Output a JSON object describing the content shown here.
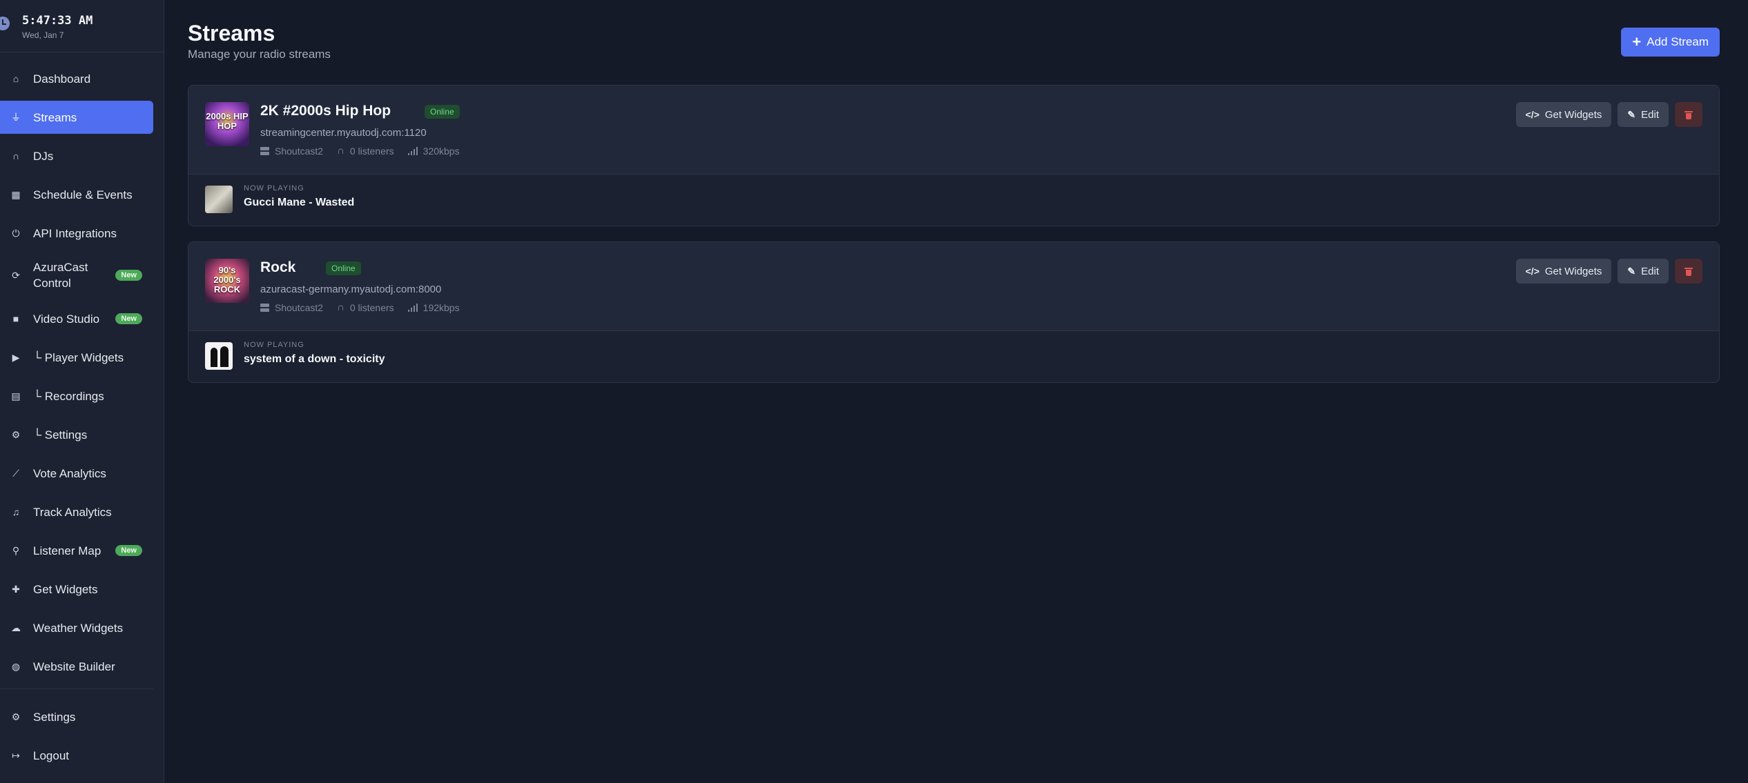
{
  "clock": {
    "time": "5:47:33 AM",
    "date": "Wed, Jan 7"
  },
  "sidebar": {
    "items": [
      {
        "label": "Dashboard",
        "icon": "home-icon"
      },
      {
        "label": "Streams",
        "icon": "broadcast-tower-icon",
        "active": true
      },
      {
        "label": "DJs",
        "icon": "headphones-icon"
      },
      {
        "label": "Schedule & Events",
        "icon": "calendar-icon"
      },
      {
        "label": "API Integrations",
        "icon": "plug-icon"
      },
      {
        "label": "AzuraCast Control",
        "icon": "sync-icon",
        "badge": "New"
      },
      {
        "label": "Video Studio",
        "icon": "video-icon",
        "badge": "New"
      },
      {
        "label": "└ Player Widgets",
        "icon": "play-circle-icon"
      },
      {
        "label": "└ Recordings",
        "icon": "film-icon"
      },
      {
        "label": "└ Settings",
        "icon": "gear-icon"
      },
      {
        "label": "Vote Analytics",
        "icon": "line-chart-icon"
      },
      {
        "label": "Track Analytics",
        "icon": "music-icon"
      },
      {
        "label": "Listener Map",
        "icon": "map-icon",
        "badge": "New"
      },
      {
        "label": "Get Widgets",
        "icon": "puzzle-icon"
      },
      {
        "label": "Weather Widgets",
        "icon": "cloud-sun-icon"
      },
      {
        "label": "Website Builder",
        "icon": "globe-icon"
      }
    ],
    "footer": [
      {
        "label": "Settings",
        "icon": "gear-icon"
      },
      {
        "label": "Logout",
        "icon": "logout-icon"
      }
    ]
  },
  "header": {
    "title": "Streams",
    "subtitle": "Manage your radio streams",
    "add_button": "Add Stream"
  },
  "streams": [
    {
      "name": "2K #2000s Hip Hop",
      "status": "Online",
      "url": "streamingcenter.myautodj.com:1120",
      "server_type": "Shoutcast2",
      "listeners": "0 listeners",
      "bitrate": "320kbps",
      "cover_text": "2000s HIP HOP",
      "get_widgets": "Get Widgets",
      "edit": "Edit",
      "now_playing_label": "NOW PLAYING",
      "now_playing": "Gucci Mane - Wasted"
    },
    {
      "name": "Rock",
      "status": "Online",
      "url": "azuracast-germany.myautodj.com:8000",
      "server_type": "Shoutcast2",
      "listeners": "0 listeners",
      "bitrate": "192kbps",
      "cover_text": "90's 2000's ROCK",
      "get_widgets": "Get Widgets",
      "edit": "Edit",
      "now_playing_label": "NOW PLAYING",
      "now_playing": "system of a down - toxicity"
    }
  ],
  "colors": {
    "accent": "#4f6ef0",
    "online_badge_bg": "#1f4d2f",
    "online_badge_text": "#6fd68a",
    "new_badge": "#4ea95a",
    "danger": "#e05555"
  }
}
